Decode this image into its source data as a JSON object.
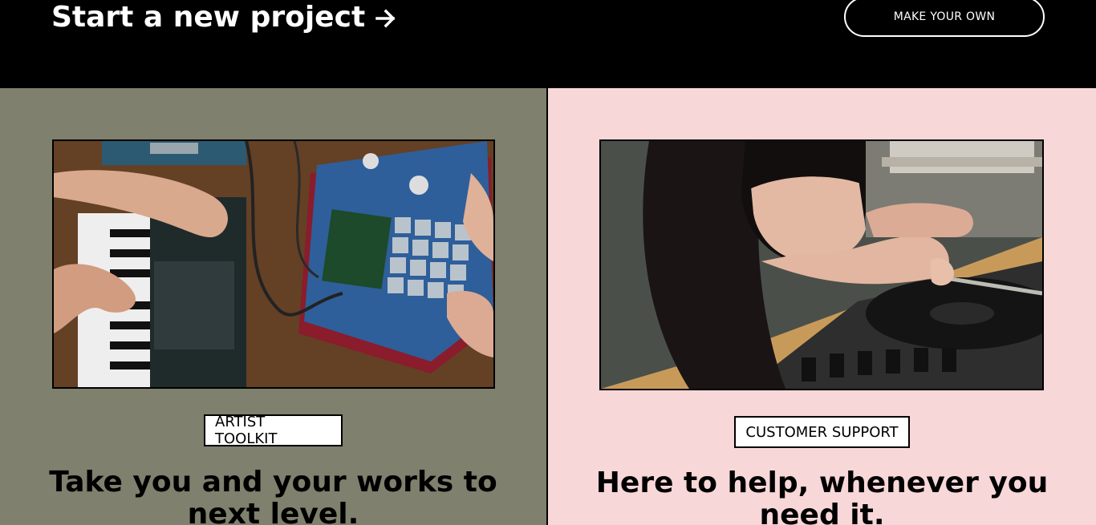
{
  "header": {
    "title": "Start a new project",
    "arrow_icon": "arrow-right-icon",
    "button_label": "MAKE YOUR OWN"
  },
  "cards": [
    {
      "tag": "ARTIST TOOLKIT",
      "heading": "Take you and your works to next level.",
      "background": "#7f806d",
      "image_icon": "music-gear-photo"
    },
    {
      "tag": "CUSTOMER SUPPORT",
      "heading": "Here to help, whenever you need it.",
      "background": "#f8d7d9",
      "image_icon": "turntable-photo"
    }
  ],
  "colors": {
    "header_bg": "#000000",
    "header_text": "#ffffff"
  }
}
